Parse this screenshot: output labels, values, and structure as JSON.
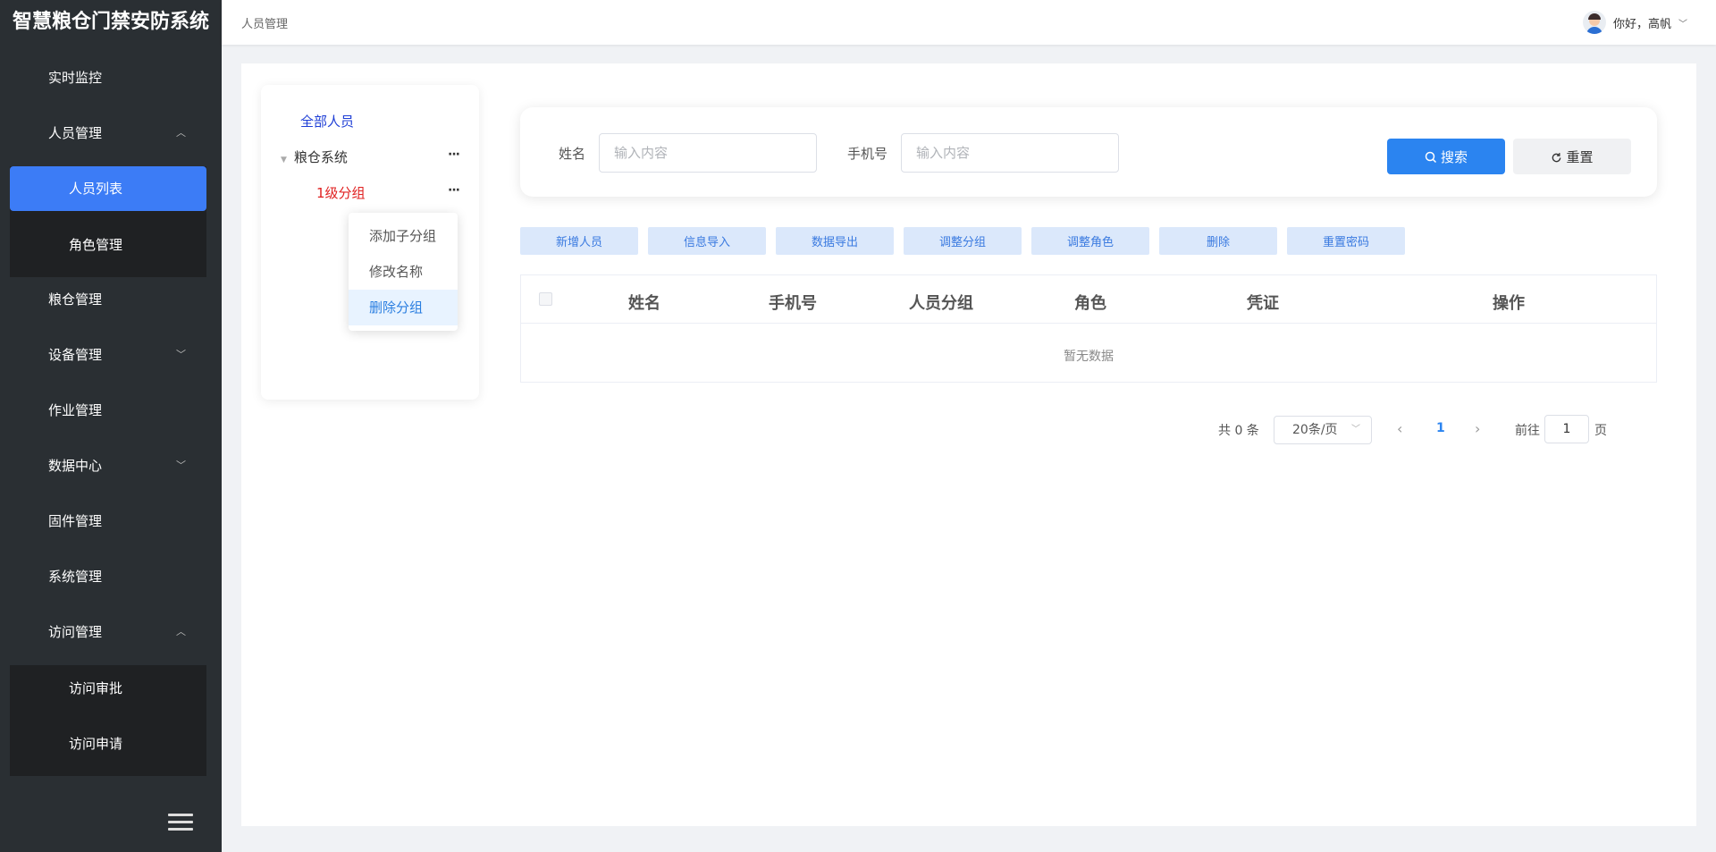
{
  "app": {
    "title": "智慧粮仓门禁安防系统"
  },
  "sidebar": {
    "items": [
      {
        "label": "实时监控"
      },
      {
        "label": "人员管理",
        "chevron": "︿"
      },
      {
        "label": "粮仓管理"
      },
      {
        "label": "设备管理",
        "chevron": "﹀"
      },
      {
        "label": "作业管理"
      },
      {
        "label": "数据中心",
        "chevron": "﹀"
      },
      {
        "label": "固件管理"
      },
      {
        "label": "系统管理"
      },
      {
        "label": "访问管理",
        "chevron": "︿"
      }
    ],
    "personnel_sub": [
      {
        "label": "人员列表",
        "active": true
      },
      {
        "label": "角色管理"
      }
    ],
    "access_sub": [
      {
        "label": "访问审批"
      },
      {
        "label": "访问申请"
      }
    ],
    "collapse_icon": "menu-fold-icon"
  },
  "header": {
    "breadcrumb": "人员管理",
    "greeting": "你好，高帆",
    "caret": "﹀"
  },
  "tree": {
    "all_label": "全部人员",
    "root_label": "粮仓系统",
    "root_toggle": "▼",
    "child_label": "1级分组",
    "more": "···",
    "context_menu": [
      {
        "label": "添加子分组"
      },
      {
        "label": "修改名称"
      },
      {
        "label": "删除分组",
        "highlighted": true
      }
    ]
  },
  "search": {
    "name_label": "姓名",
    "name_placeholder": "输入内容",
    "phone_label": "手机号",
    "phone_placeholder": "输入内容",
    "search_label": "搜索",
    "reset_label": "重置"
  },
  "actions": [
    "新增人员",
    "信息导入",
    "数据导出",
    "调整分组",
    "调整角色",
    "删除",
    "重置密码"
  ],
  "table": {
    "columns": [
      "姓名",
      "手机号",
      "人员分组",
      "角色",
      "凭证",
      "操作"
    ],
    "empty_text": "暂无数据"
  },
  "pagination": {
    "total_text": "共 0 条",
    "page_size": "20条/页",
    "prev": "‹",
    "next": "›",
    "current_page": "1",
    "goto_label": "前往",
    "goto_value": "1",
    "page_suffix": "页"
  },
  "colors": {
    "primary": "#2b84f0",
    "sidebar_bg": "#2a2f33",
    "active_item": "#3c7cf6",
    "tree_leaf": "#e02020"
  }
}
